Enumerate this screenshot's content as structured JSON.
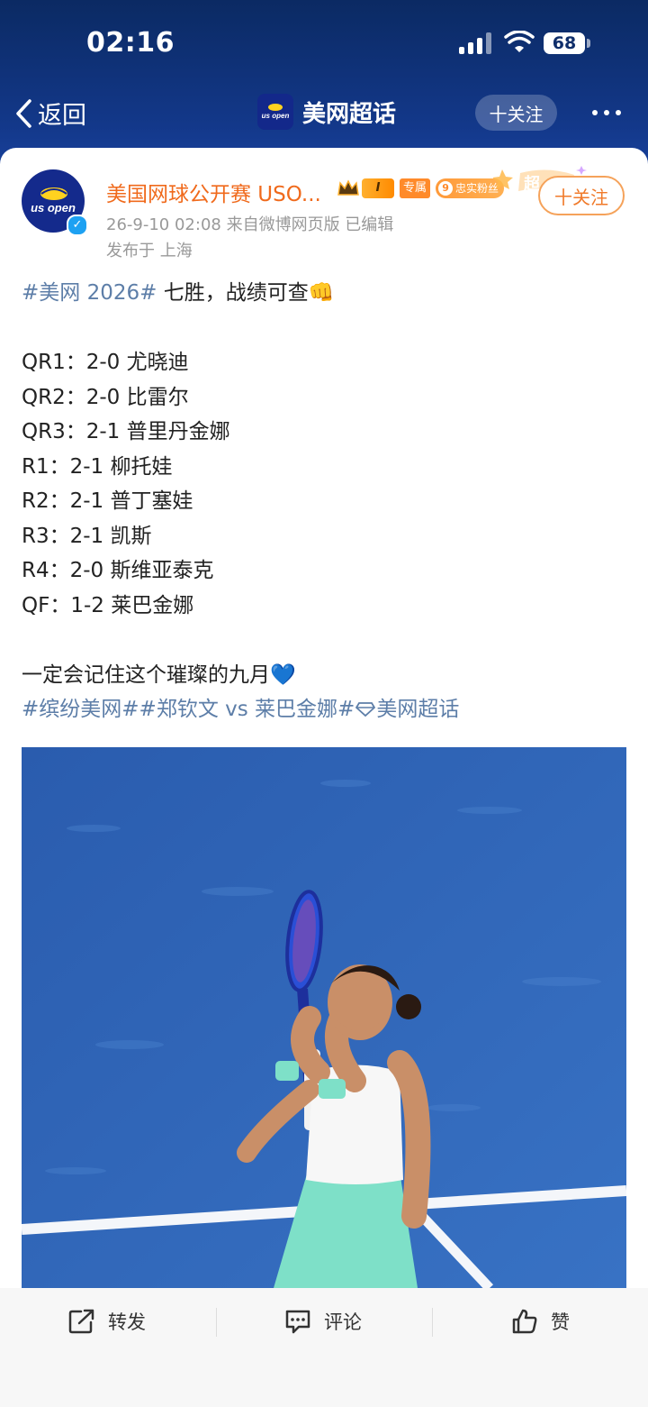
{
  "status": {
    "time": "02:16",
    "battery": "68"
  },
  "nav": {
    "back_label": "返回",
    "title": "美网超话",
    "follow_label": "十关注"
  },
  "post": {
    "author": "美国网球公开赛 USO...",
    "badges": {
      "level": "I",
      "exclusive": "专属",
      "fan_level": "9",
      "fan_label": "忠实粉丝",
      "super_label": "超"
    },
    "follow_label": "十关注",
    "meta": "26-9-10 02:08   来自微博网页版   已编辑",
    "location": "发布于 上海",
    "lines": {
      "topic_2026": "#美网 2026#",
      "headline_rest": " 七胜，战绩可查👊",
      "qr1": "QR1：2-0 尤晓迪",
      "qr2": "QR2：2-0 比雷尔",
      "qr3": "QR3：2-1 普里丹金娜",
      "r1": "R1：2-1 柳托娃",
      "r2": "R2：2-1 普丁塞娃",
      "r3": "R3：2-1 凯斯",
      "r4": "R4：2-0 斯维亚泰克",
      "qf": "QF：1-2 莱巴金娜",
      "closing": "一定会记住这个璀璨的九月💙",
      "topics_a": "#缤纷美网##郑钦文 vs 莱巴金娜#",
      "topics_b": "美网超话"
    },
    "logo_text": "us open"
  },
  "actions": {
    "repost": "转发",
    "comment": "评论",
    "like": "赞"
  },
  "colors": {
    "header": "#13388a",
    "author": "#f06a1c",
    "topic": "#5d7ea8",
    "court": "#2c62b4"
  }
}
